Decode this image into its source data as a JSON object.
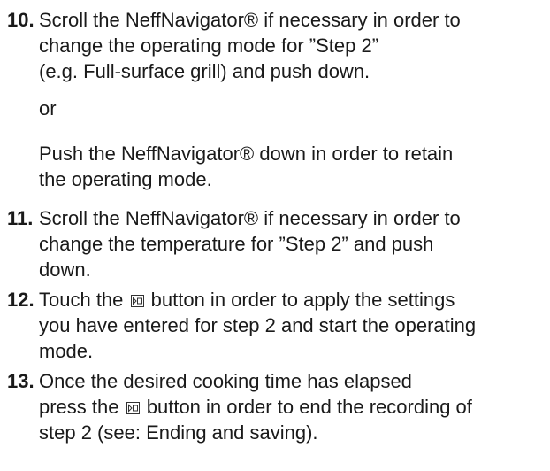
{
  "steps": [
    {
      "number": "10.",
      "lines": [
        "Scroll the NeffNavigator® if necessary in order to",
        "change the operating mode for ”Step 2”",
        "(e.g. Full-surface grill) and push down."
      ],
      "alt_word": "or",
      "alt_lines": [
        "Push the NeffNavigator® down in order to retain",
        "the operating mode."
      ]
    },
    {
      "number": "11.",
      "lines": [
        "Scroll the NeffNavigator® if necessary in order to",
        "change the temperature for ”Step 2” and push",
        "down."
      ]
    },
    {
      "number": "12.",
      "line1_before_icon": "Touch the",
      "line1_after_icon": "button in order to apply the settings",
      "lines": [
        "you have entered for step 2 and start the operating",
        "mode."
      ]
    },
    {
      "number": "13.",
      "line1": "Once the desired cooking time has elapsed",
      "line2_before_icon": "press the",
      "line2_after_icon": "button in order to end the recording of",
      "line3": "step 2 (see: Ending and saving)."
    }
  ],
  "icons": {
    "record_button": "record-stop-button-icon"
  }
}
